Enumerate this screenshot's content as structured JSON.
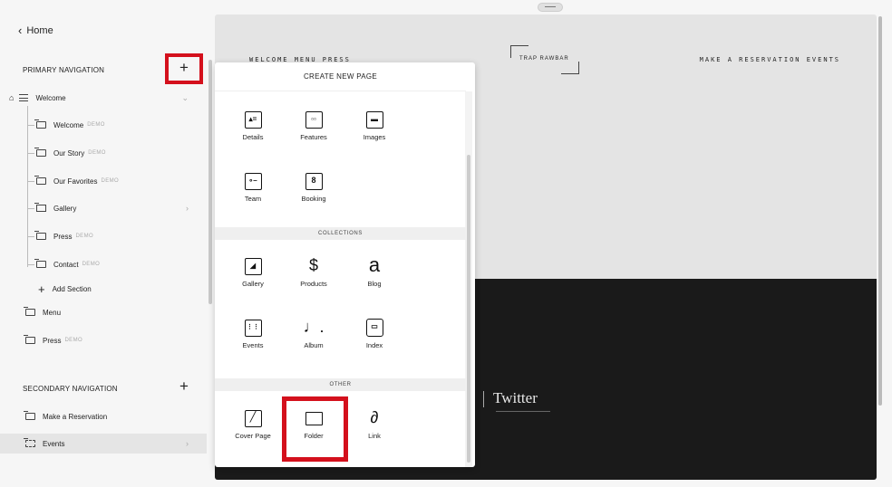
{
  "sidebar": {
    "home_label": "Home",
    "primary_header": "PRIMARY NAVIGATION",
    "secondary_header": "SECONDARY NAVIGATION",
    "plus": "+",
    "items": [
      {
        "label": "Welcome",
        "demo": ""
      },
      {
        "label": "Welcome",
        "demo": "DEMO"
      },
      {
        "label": "Our Story",
        "demo": "DEMO"
      },
      {
        "label": "Our Favorites",
        "demo": "DEMO"
      },
      {
        "label": "Gallery",
        "demo": ""
      },
      {
        "label": "Press",
        "demo": "DEMO"
      },
      {
        "label": "Contact",
        "demo": "DEMO"
      },
      {
        "label": "Add Section",
        "demo": ""
      },
      {
        "label": "Menu",
        "demo": ""
      },
      {
        "label": "Press",
        "demo": "DEMO"
      }
    ],
    "secondary_items": [
      {
        "label": "Make a Reservation"
      },
      {
        "label": "Events"
      }
    ]
  },
  "site_preview": {
    "nav_left": "WELCOME  MENU  PRESS",
    "logo": "TRAP RAWBAR",
    "nav_right": "MAKE A RESERVATION  EVENTS",
    "twitter": "Twitter"
  },
  "popup": {
    "title": "CREATE NEW PAGE",
    "pages": [
      {
        "label": "Details",
        "icon": "details-icon"
      },
      {
        "label": "Features",
        "icon": "features-icon"
      },
      {
        "label": "Images",
        "icon": "images-icon"
      },
      {
        "label": "Team",
        "icon": "team-icon"
      },
      {
        "label": "Booking",
        "icon": "booking-icon",
        "glyph": "8"
      }
    ],
    "collections_header": "COLLECTIONS",
    "collections": [
      {
        "label": "Gallery",
        "icon": "gallery-icon"
      },
      {
        "label": "Products",
        "icon": "products-icon",
        "glyph": "$"
      },
      {
        "label": "Blog",
        "icon": "blog-icon",
        "glyph": "a"
      },
      {
        "label": "Events",
        "icon": "calendar-icon"
      },
      {
        "label": "Album",
        "icon": "album-icon",
        "glyph": "♩."
      },
      {
        "label": "Index",
        "icon": "index-icon"
      }
    ],
    "other_header": "OTHER",
    "other": [
      {
        "label": "Cover Page",
        "icon": "cover-page-icon"
      },
      {
        "label": "Folder",
        "icon": "folder-icon"
      },
      {
        "label": "Link",
        "icon": "link-icon",
        "glyph": "🔗"
      }
    ]
  },
  "colors": {
    "highlight": "#d4101c",
    "dark_section": "#1a1a1a"
  }
}
